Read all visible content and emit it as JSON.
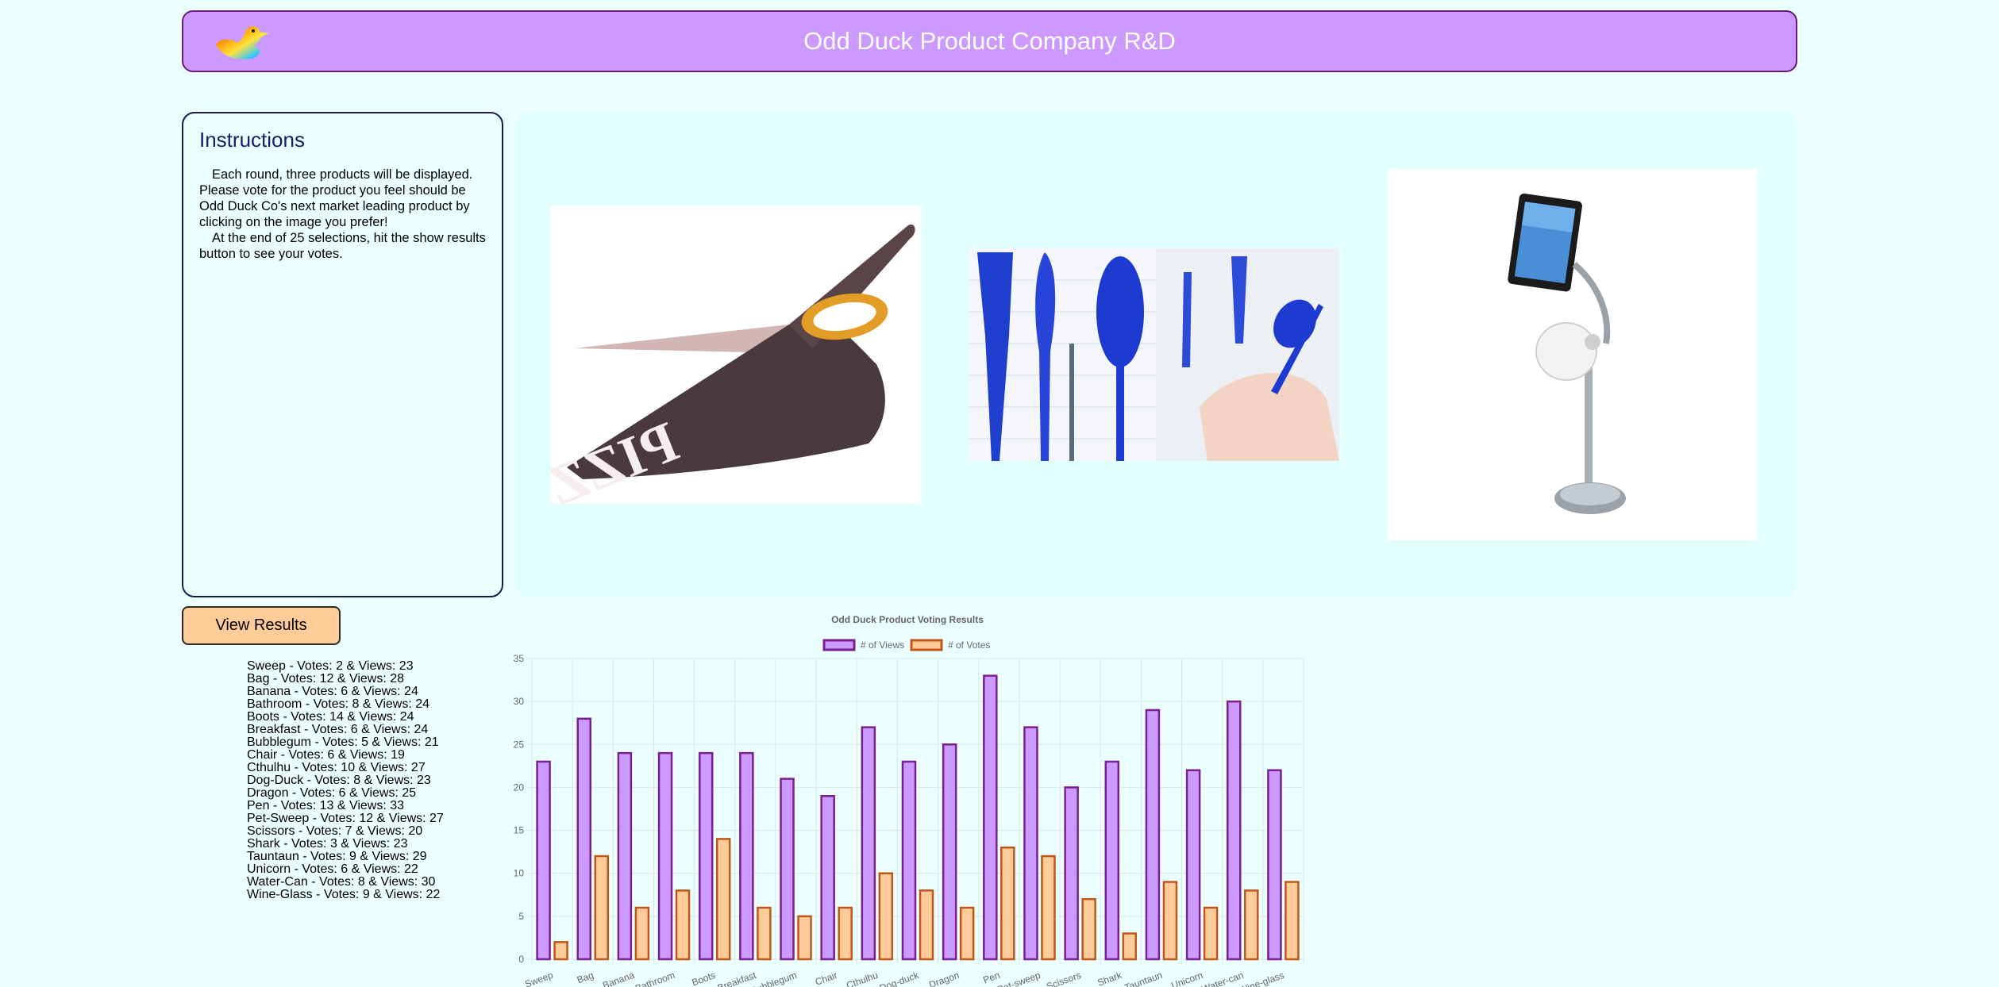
{
  "header": {
    "title": "Odd Duck Product Company R&D",
    "logo_icon": "duck-logo-icon"
  },
  "instructions": {
    "heading": "Instructions",
    "paragraph_1": "Each round, three products will be displayed. Please vote for the product you feel should be Odd Duck Co's next market leading product by clicking on the image you prefer!",
    "paragraph_2": "At the end of 25 selections, hit the show results button to see your votes."
  },
  "products": [
    {
      "name": "pizza-scissors",
      "icon": "pizza-scissors-image"
    },
    {
      "name": "pen-utensils",
      "icon": "pen-utensils-image"
    },
    {
      "name": "bathroom-tablet-stand",
      "icon": "tablet-toilet-paper-stand-image"
    }
  ],
  "view_results_label": "View Results",
  "results": [
    "Sweep - Votes: 2 & Views: 23",
    "Bag - Votes: 12 & Views: 28",
    "Banana - Votes: 6 & Views: 24",
    "Bathroom - Votes: 8 & Views: 24",
    "Boots - Votes: 14 & Views: 24",
    "Breakfast - Votes: 6 & Views: 24",
    "Bubblegum - Votes: 5 & Views: 21",
    "Chair - Votes: 6 & Views: 19",
    "Cthulhu - Votes: 10 & Views: 27",
    "Dog-Duck - Votes: 8 & Views: 23",
    "Dragon - Votes: 6 & Views: 25",
    "Pen - Votes: 13 & Views: 33",
    "Pet-Sweep - Votes: 12 & Views: 27",
    "Scissors - Votes: 7 & Views: 20",
    "Shark - Votes: 3 & Views: 23",
    "Tauntaun - Votes: 9 & Views: 29",
    "Unicorn - Votes: 6 & Views: 22",
    "Water-Can - Votes: 8 & Views: 30",
    "Wine-Glass - Votes: 9 & Views: 22"
  ],
  "colors": {
    "views_fill": "#cc99ff",
    "views_border": "#7a1f8f",
    "votes_fill": "#ffcc99",
    "votes_border": "#c0561a",
    "header_bg": "#cc99ff",
    "page_bg": "#ebfffe"
  },
  "chart_data": {
    "type": "bar",
    "title": "Odd Duck Product Voting Results",
    "categories": [
      "Sweep",
      "Bag",
      "Banana",
      "Bathroom",
      "Boots",
      "Breakfast",
      "Bubblegum",
      "Chair",
      "Cthulhu",
      "Dog-duck",
      "Dragon",
      "Pen",
      "Pet-sweep",
      "Scissors",
      "Shark",
      "Tauntaun",
      "Unicorn",
      "Water-can",
      "Wine-glass"
    ],
    "series": [
      {
        "name": "# of Views",
        "values": [
          23,
          28,
          24,
          24,
          24,
          24,
          21,
          19,
          27,
          23,
          25,
          33,
          27,
          20,
          23,
          29,
          22,
          30,
          22
        ]
      },
      {
        "name": "# of Votes",
        "values": [
          2,
          12,
          6,
          8,
          14,
          6,
          5,
          6,
          10,
          8,
          6,
          13,
          12,
          7,
          3,
          9,
          6,
          8,
          9
        ]
      }
    ],
    "yticks": [
      "0",
      "5",
      "10",
      "15",
      "20",
      "25",
      "30",
      "35"
    ],
    "ylim": [
      0,
      35
    ],
    "grid": true,
    "legend_position": "top"
  }
}
